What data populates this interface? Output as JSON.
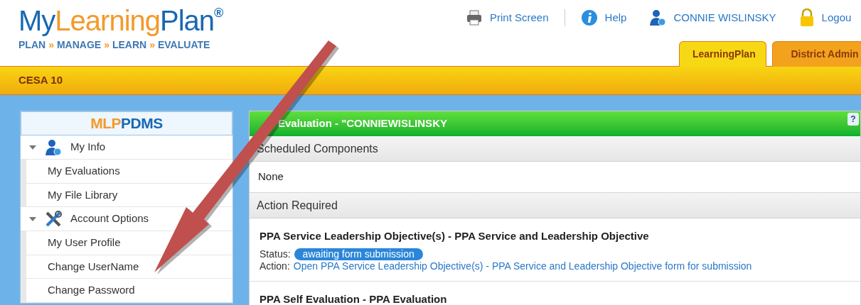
{
  "logo": {
    "part_1": "My",
    "part_2": "Learning",
    "part_3": "Plan",
    "mark": "®",
    "tagline": [
      {
        "text": "PLAN"
      },
      {
        "text": "»",
        "kind": "sep"
      },
      {
        "text": "MANAGE"
      },
      {
        "text": "»",
        "kind": "sep"
      },
      {
        "text": "LEARN"
      },
      {
        "text": "»",
        "kind": "sep"
      },
      {
        "text": "EVALUATE"
      }
    ]
  },
  "top_links": [
    {
      "label": "Print Screen"
    },
    {
      "label": "Help"
    },
    {
      "label": "CONNIE WISLINSKY"
    },
    {
      "label": "Logou"
    }
  ],
  "tabs": [
    {
      "label": "LearningPlan",
      "selected": true
    },
    {
      "label": "District Admin",
      "selected": false
    }
  ],
  "org_bar": {
    "title": "CESA 10"
  },
  "sidebar": {
    "brand_1": "MLP",
    "brand_2": "PDMS",
    "groups": [
      {
        "label": "My Info",
        "expanded": true,
        "items": [
          "My Evaluations",
          "My File Library"
        ]
      },
      {
        "label": "Account Options",
        "expanded": true,
        "items": [
          "My User Profile",
          "Change UserName",
          "Change Password"
        ]
      }
    ]
  },
  "panel": {
    "title": "Evaluation - \"CONNIEWISLINSKY",
    "help": "?",
    "sections": [
      {
        "heading": "Scheduled Components",
        "rows": [
          {
            "kind": "plain",
            "text": "None"
          }
        ]
      },
      {
        "heading": "Action Required",
        "rows": [
          {
            "kind": "task",
            "title": "PPA Service Leadership Objective(s) - PPA Service and Leadership Objective",
            "status_label": "Status:",
            "status": "awaiting form submission",
            "action_label": "Action:",
            "action": "Open PPA Service Leadership Objective(s) - PPA Service and Leadership Objective form for submission"
          },
          {
            "kind": "task",
            "title": "PPA Self Evaluation - PPA Evaluation"
          }
        ]
      }
    ]
  },
  "annotation": {
    "kind": "arrow"
  }
}
